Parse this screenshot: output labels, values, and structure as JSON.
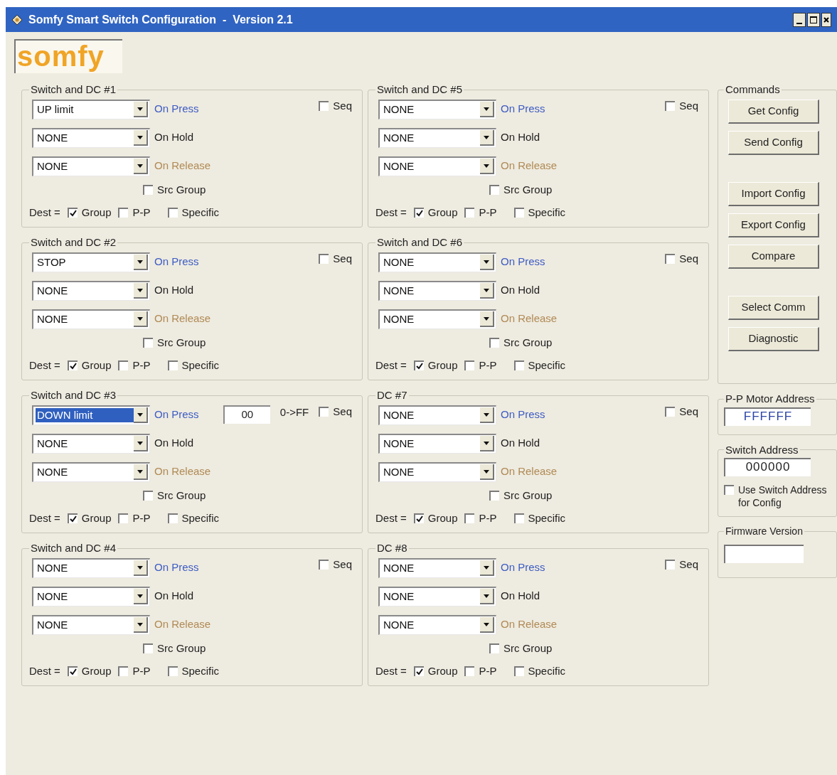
{
  "window": {
    "title": "Somfy Smart Switch Configuration  -  Version 2.1"
  },
  "logo": "somfy",
  "groups": [
    {
      "title": "Switch and DC #1",
      "actions": [
        {
          "kind": "press",
          "value": "UP limit",
          "label": "On Press",
          "highlighted": false
        },
        {
          "kind": "hold",
          "value": "NONE",
          "label": "On Hold",
          "highlighted": false
        },
        {
          "kind": "release",
          "value": "NONE",
          "label": "On Release",
          "highlighted": false
        }
      ],
      "seq": {
        "label": "Seq",
        "checked": false
      },
      "src_group": {
        "label": "Src Group",
        "checked": false
      },
      "dest": {
        "label": "Dest =",
        "options": [
          {
            "label": "Group",
            "checked": true
          },
          {
            "label": "P-P",
            "checked": false
          },
          {
            "label": "Specific",
            "checked": false
          }
        ]
      }
    },
    {
      "title": "Switch and DC #2",
      "actions": [
        {
          "kind": "press",
          "value": "STOP",
          "label": "On Press",
          "highlighted": false
        },
        {
          "kind": "hold",
          "value": "NONE",
          "label": "On Hold",
          "highlighted": false
        },
        {
          "kind": "release",
          "value": "NONE",
          "label": "On Release",
          "highlighted": false
        }
      ],
      "seq": {
        "label": "Seq",
        "checked": false
      },
      "src_group": {
        "label": "Src Group",
        "checked": false
      },
      "dest": {
        "label": "Dest =",
        "options": [
          {
            "label": "Group",
            "checked": true
          },
          {
            "label": "P-P",
            "checked": false
          },
          {
            "label": "Specific",
            "checked": false
          }
        ]
      }
    },
    {
      "title": "Switch and DC #3",
      "actions": [
        {
          "kind": "press",
          "value": "DOWN limit",
          "label": "On Press",
          "highlighted": true
        },
        {
          "kind": "hold",
          "value": "NONE",
          "label": "On Hold",
          "highlighted": false
        },
        {
          "kind": "release",
          "value": "NONE",
          "label": "On Release",
          "highlighted": false
        }
      ],
      "hex": {
        "value": "00",
        "range": "0->FF"
      },
      "seq": {
        "label": "Seq",
        "checked": false
      },
      "src_group": {
        "label": "Src Group",
        "checked": false
      },
      "dest": {
        "label": "Dest =",
        "options": [
          {
            "label": "Group",
            "checked": true
          },
          {
            "label": "P-P",
            "checked": false
          },
          {
            "label": "Specific",
            "checked": false
          }
        ]
      }
    },
    {
      "title": "Switch and DC #4",
      "actions": [
        {
          "kind": "press",
          "value": "NONE",
          "label": "On Press",
          "highlighted": false
        },
        {
          "kind": "hold",
          "value": "NONE",
          "label": "On Hold",
          "highlighted": false
        },
        {
          "kind": "release",
          "value": "NONE",
          "label": "On Release",
          "highlighted": false
        }
      ],
      "seq": {
        "label": "Seq",
        "checked": false
      },
      "src_group": {
        "label": "Src Group",
        "checked": false
      },
      "dest": {
        "label": "Dest =",
        "options": [
          {
            "label": "Group",
            "checked": true
          },
          {
            "label": "P-P",
            "checked": false
          },
          {
            "label": "Specific",
            "checked": false
          }
        ]
      }
    },
    {
      "title": "Switch and DC #5",
      "actions": [
        {
          "kind": "press",
          "value": "NONE",
          "label": "On Press",
          "highlighted": false
        },
        {
          "kind": "hold",
          "value": "NONE",
          "label": "On Hold",
          "highlighted": false
        },
        {
          "kind": "release",
          "value": "NONE",
          "label": "On Release",
          "highlighted": false
        }
      ],
      "seq": {
        "label": "Seq",
        "checked": false
      },
      "src_group": {
        "label": "Src Group",
        "checked": false
      },
      "dest": {
        "label": "Dest =",
        "options": [
          {
            "label": "Group",
            "checked": true
          },
          {
            "label": "P-P",
            "checked": false
          },
          {
            "label": "Specific",
            "checked": false
          }
        ]
      }
    },
    {
      "title": "Switch and DC #6",
      "actions": [
        {
          "kind": "press",
          "value": "NONE",
          "label": "On Press",
          "highlighted": false
        },
        {
          "kind": "hold",
          "value": "NONE",
          "label": "On Hold",
          "highlighted": false
        },
        {
          "kind": "release",
          "value": "NONE",
          "label": "On Release",
          "highlighted": false
        }
      ],
      "seq": {
        "label": "Seq",
        "checked": false
      },
      "src_group": {
        "label": "Src Group",
        "checked": false
      },
      "dest": {
        "label": "Dest =",
        "options": [
          {
            "label": "Group",
            "checked": true
          },
          {
            "label": "P-P",
            "checked": false
          },
          {
            "label": "Specific",
            "checked": false
          }
        ]
      }
    },
    {
      "title": "DC #7",
      "actions": [
        {
          "kind": "press",
          "value": "NONE",
          "label": "On Press",
          "highlighted": false
        },
        {
          "kind": "hold",
          "value": "NONE",
          "label": "On Hold",
          "highlighted": false
        },
        {
          "kind": "release",
          "value": "NONE",
          "label": "On Release",
          "highlighted": false
        }
      ],
      "seq": {
        "label": "Seq",
        "checked": false
      },
      "src_group": {
        "label": "Src Group",
        "checked": false
      },
      "dest": {
        "label": "Dest =",
        "options": [
          {
            "label": "Group",
            "checked": true
          },
          {
            "label": "P-P",
            "checked": false
          },
          {
            "label": "Specific",
            "checked": false
          }
        ]
      }
    },
    {
      "title": "DC #8",
      "actions": [
        {
          "kind": "press",
          "value": "NONE",
          "label": "On Press",
          "highlighted": false
        },
        {
          "kind": "hold",
          "value": "NONE",
          "label": "On Hold",
          "highlighted": false
        },
        {
          "kind": "release",
          "value": "NONE",
          "label": "On Release",
          "highlighted": false
        }
      ],
      "seq": {
        "label": "Seq",
        "checked": false
      },
      "src_group": {
        "label": "Src Group",
        "checked": false
      },
      "dest": {
        "label": "Dest =",
        "options": [
          {
            "label": "Group",
            "checked": true
          },
          {
            "label": "P-P",
            "checked": false
          },
          {
            "label": "Specific",
            "checked": false
          }
        ]
      }
    }
  ],
  "commands": {
    "title": "Commands",
    "button_groups": [
      [
        "Get Config",
        "Send Config"
      ],
      [
        "Import Config",
        "Export Config",
        "Compare"
      ],
      [
        "Select Comm",
        "Diagnostic"
      ]
    ]
  },
  "pp_motor_address": {
    "title": "P-P Motor Address",
    "value": "FFFFFF"
  },
  "switch_address": {
    "title": "Switch Address",
    "value": "000000",
    "use_for_config": {
      "label": "Use Switch Address for Config",
      "checked": false
    }
  },
  "firmware_version": {
    "title": "Firmware Version"
  }
}
